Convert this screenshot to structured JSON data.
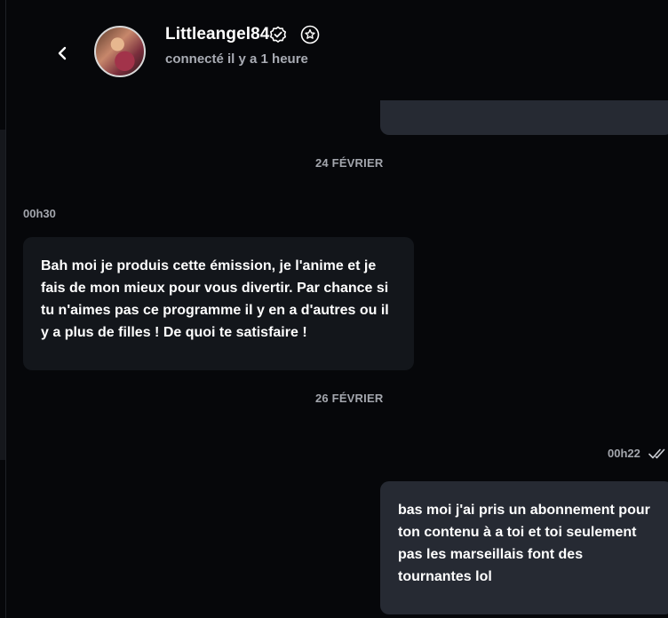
{
  "header": {
    "username": "Littleangel84",
    "status": "connecté il y a 1 heure"
  },
  "messages": [
    {
      "date": "24 FÉVRIER",
      "time": "00h30",
      "direction": "incoming",
      "text": "Bah moi je produis cette émission, je l'anime et je fais de mon mieux pour vous divertir. Par chance si tu n'aimes pas ce programme il y en a d'autres ou il y a plus de filles ! De quoi te satisfaire !"
    },
    {
      "date": "26 FÉVRIER",
      "time": "00h22",
      "direction": "outgoing",
      "read": true,
      "text": "bas moi j'ai pris un abonnement pour ton contenu à a toi et toi seulement pas les marseillais font des tournantes lol"
    }
  ],
  "colors": {
    "background": "#06070a",
    "incoming_bubble": "#13161b",
    "outgoing_bubble": "#262a33",
    "muted_text": "#a3a6ad"
  },
  "icons": {
    "back": "chevron-left-icon",
    "verified": "verified-badge-icon",
    "favorite": "star-badge-icon",
    "read_receipt": "double-check-icon"
  }
}
